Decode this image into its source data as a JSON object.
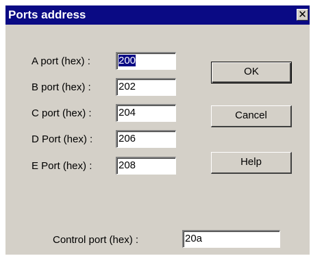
{
  "window": {
    "title": "Ports address",
    "close_glyph": "✕"
  },
  "fields": [
    {
      "label": "A port (hex) :",
      "value": "200"
    },
    {
      "label": "B port (hex) :",
      "value": "202"
    },
    {
      "label": "C port (hex) :",
      "value": "204"
    },
    {
      "label": "D Port (hex) :",
      "value": "206"
    },
    {
      "label": "E Port (hex) :",
      "value": "208"
    }
  ],
  "control": {
    "label": "Control port (hex) :",
    "value": "20a"
  },
  "buttons": {
    "ok": "OK",
    "cancel": "Cancel",
    "help": "Help"
  }
}
